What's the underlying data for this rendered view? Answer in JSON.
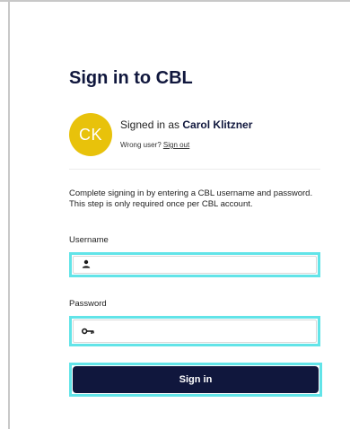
{
  "page": {
    "title": "Sign in to CBL"
  },
  "user": {
    "initials": "CK",
    "signed_in_prefix": "Signed in as ",
    "name": "Carol Klitzner",
    "wrong_user_text": "Wrong user? ",
    "sign_out_link": "Sign out"
  },
  "description": "Complete signing in by entering a CBL username and password. This step is only required once per CBL account.",
  "form": {
    "username_label": "Username",
    "username_value": "",
    "password_label": "Password",
    "password_value": "",
    "submit_label": "Sign in"
  },
  "colors": {
    "primary": "#10173d",
    "avatar": "#e8c20b",
    "focus_highlight": "#62e4e8"
  },
  "icons": {
    "username_icon": "user-icon",
    "password_icon": "key-icon"
  }
}
